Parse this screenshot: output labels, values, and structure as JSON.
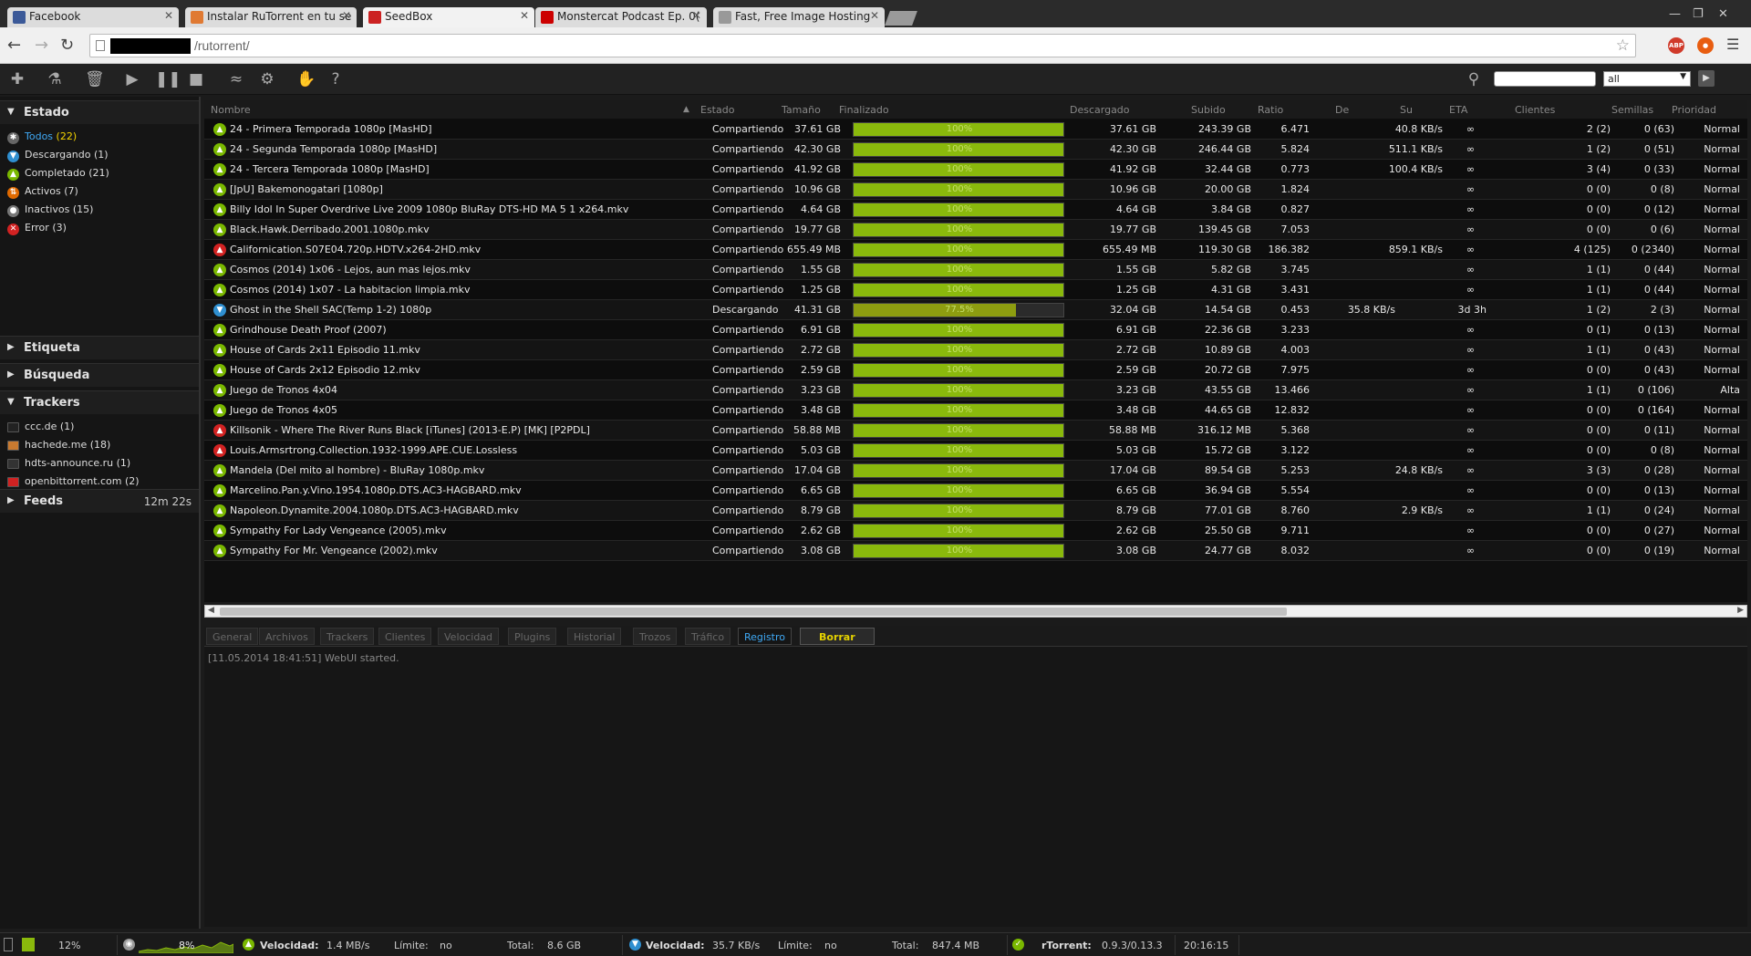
{
  "browser": {
    "tabs": [
      {
        "title": "Facebook",
        "active": false,
        "color": "#3b5998"
      },
      {
        "title": "Instalar RuTorrent en tu se",
        "active": false,
        "color": "#e07a33"
      },
      {
        "title": "SeedBox",
        "active": true,
        "color": "#cc2222"
      },
      {
        "title": "Monstercat Podcast Ep. 0(",
        "active": false,
        "color": "#cc0000"
      },
      {
        "title": "Fast, Free Image Hosting",
        "active": false,
        "color": "#999999"
      }
    ],
    "url": "/rutorrent/",
    "extensions": {
      "abp": "ABP"
    }
  },
  "search": {
    "filter_value": "all"
  },
  "sidebar": {
    "estado": {
      "title": "Estado",
      "items": [
        {
          "label": "Todos",
          "count": "(22)",
          "selected": true,
          "icon": "all-icon",
          "color": "#666666",
          "glyph": "✱"
        },
        {
          "label": "Descargando",
          "count": "(1)",
          "selected": false,
          "icon": "download-icon",
          "color": "#2f8fd0",
          "glyph": "▼"
        },
        {
          "label": "Completado",
          "count": "(21)",
          "selected": false,
          "icon": "complete-icon",
          "color": "#7ab800",
          "glyph": "▲"
        },
        {
          "label": "Activos",
          "count": "(7)",
          "selected": false,
          "icon": "active-icon",
          "color": "#e06a00",
          "glyph": "⇅"
        },
        {
          "label": "Inactivos",
          "count": "(15)",
          "selected": false,
          "icon": "inactive-icon",
          "color": "#777777",
          "glyph": "●"
        },
        {
          "label": "Error",
          "count": "(3)",
          "selected": false,
          "icon": "error-icon",
          "color": "#d22222",
          "glyph": "✕"
        }
      ]
    },
    "etiqueta": {
      "title": "Etiqueta"
    },
    "busqueda": {
      "title": "Búsqueda"
    },
    "trackers": {
      "title": "Trackers",
      "items": [
        {
          "label": "ccc.de (1)",
          "color": "#222222"
        },
        {
          "label": "hachede.me (18)",
          "color": "#c87a30"
        },
        {
          "label": "hdts-announce.ru (1)",
          "color": "#333333"
        },
        {
          "label": "openbittorrent.com (2)",
          "color": "#d02222"
        }
      ]
    },
    "feeds": {
      "title": "Feeds",
      "time": "12m 22s"
    }
  },
  "table": {
    "headers": {
      "name": "Nombre",
      "sort": "▲",
      "status": "Estado",
      "size": "Tamaño",
      "done": "Finalizado",
      "downloaded": "Descargado",
      "uploaded": "Subido",
      "ratio": "Ratio",
      "down": "De",
      "up": "Su",
      "eta": "ETA",
      "peers": "Clientes",
      "seeds": "Semillas",
      "priority": "Prioridad"
    },
    "rows": [
      {
        "state": "seed",
        "name": "24 - Primera Temporada 1080p [MasHD]",
        "status": "Compartiendo",
        "size": "37.61 GB",
        "pct": "100%",
        "done": 100,
        "downloaded": "37.61 GB",
        "uploaded": "243.39 GB",
        "ratio": "6.471",
        "dl": "",
        "ul": "40.8 KB/s",
        "eta": "∞",
        "peers": "2 (2)",
        "seeds": "0 (63)",
        "priority": "Normal"
      },
      {
        "state": "seed",
        "name": "24 - Segunda Temporada 1080p [MasHD]",
        "status": "Compartiendo",
        "size": "42.30 GB",
        "pct": "100%",
        "done": 100,
        "downloaded": "42.30 GB",
        "uploaded": "246.44 GB",
        "ratio": "5.824",
        "dl": "",
        "ul": "511.1 KB/s",
        "eta": "∞",
        "peers": "1 (2)",
        "seeds": "0 (51)",
        "priority": "Normal"
      },
      {
        "state": "seed",
        "name": "24 - Tercera Temporada 1080p [MasHD]",
        "status": "Compartiendo",
        "size": "41.92 GB",
        "pct": "100%",
        "done": 100,
        "downloaded": "41.92 GB",
        "uploaded": "32.44 GB",
        "ratio": "0.773",
        "dl": "",
        "ul": "100.4 KB/s",
        "eta": "∞",
        "peers": "3 (4)",
        "seeds": "0 (33)",
        "priority": "Normal"
      },
      {
        "state": "seed",
        "name": "[JpU] Bakemonogatari [1080p]",
        "status": "Compartiendo",
        "size": "10.96 GB",
        "pct": "100%",
        "done": 100,
        "downloaded": "10.96 GB",
        "uploaded": "20.00 GB",
        "ratio": "1.824",
        "dl": "",
        "ul": "",
        "eta": "∞",
        "peers": "0 (0)",
        "seeds": "0 (8)",
        "priority": "Normal"
      },
      {
        "state": "seed",
        "name": "Billy Idol In Super Overdrive Live 2009 1080p BluRay DTS-HD MA 5 1 x264.mkv",
        "status": "Compartiendo",
        "size": "4.64 GB",
        "pct": "100%",
        "done": 100,
        "downloaded": "4.64 GB",
        "uploaded": "3.84 GB",
        "ratio": "0.827",
        "dl": "",
        "ul": "",
        "eta": "∞",
        "peers": "0 (0)",
        "seeds": "0 (12)",
        "priority": "Normal"
      },
      {
        "state": "seed",
        "name": "Black.Hawk.Derribado.2001.1080p.mkv",
        "status": "Compartiendo",
        "size": "19.77 GB",
        "pct": "100%",
        "done": 100,
        "downloaded": "19.77 GB",
        "uploaded": "139.45 GB",
        "ratio": "7.053",
        "dl": "",
        "ul": "",
        "eta": "∞",
        "peers": "0 (0)",
        "seeds": "0 (6)",
        "priority": "Normal"
      },
      {
        "state": "error",
        "name": "Californication.S07E04.720p.HDTV.x264-2HD.mkv",
        "status": "Compartiendo",
        "size": "655.49 MB",
        "pct": "100%",
        "done": 100,
        "downloaded": "655.49 MB",
        "uploaded": "119.30 GB",
        "ratio": "186.382",
        "dl": "",
        "ul": "859.1 KB/s",
        "eta": "∞",
        "peers": "4 (125)",
        "seeds": "0 (2340)",
        "priority": "Normal"
      },
      {
        "state": "seed",
        "name": "Cosmos (2014) 1x06 - Lejos, aun mas lejos.mkv",
        "status": "Compartiendo",
        "size": "1.55 GB",
        "pct": "100%",
        "done": 100,
        "downloaded": "1.55 GB",
        "uploaded": "5.82 GB",
        "ratio": "3.745",
        "dl": "",
        "ul": "",
        "eta": "∞",
        "peers": "1 (1)",
        "seeds": "0 (44)",
        "priority": "Normal"
      },
      {
        "state": "seed",
        "name": "Cosmos (2014) 1x07 - La habitacion limpia.mkv",
        "status": "Compartiendo",
        "size": "1.25 GB",
        "pct": "100%",
        "done": 100,
        "downloaded": "1.25 GB",
        "uploaded": "4.31 GB",
        "ratio": "3.431",
        "dl": "",
        "ul": "",
        "eta": "∞",
        "peers": "1 (1)",
        "seeds": "0 (44)",
        "priority": "Normal"
      },
      {
        "state": "down",
        "name": "Ghost in the Shell SAC(Temp 1-2) 1080p",
        "status": "Descargando",
        "size": "41.31 GB",
        "pct": "77.5%",
        "done": 77.5,
        "downloaded": "32.04 GB",
        "uploaded": "14.54 GB",
        "ratio": "0.453",
        "dl": "35.8 KB/s",
        "ul": "",
        "eta": "3d 3h",
        "peers": "1 (2)",
        "seeds": "2 (3)",
        "priority": "Normal"
      },
      {
        "state": "seed",
        "name": "Grindhouse Death Proof (2007)",
        "status": "Compartiendo",
        "size": "6.91 GB",
        "pct": "100%",
        "done": 100,
        "downloaded": "6.91 GB",
        "uploaded": "22.36 GB",
        "ratio": "3.233",
        "dl": "",
        "ul": "",
        "eta": "∞",
        "peers": "0 (1)",
        "seeds": "0 (13)",
        "priority": "Normal"
      },
      {
        "state": "seed",
        "name": "House of Cards 2x11 Episodio 11.mkv",
        "status": "Compartiendo",
        "size": "2.72 GB",
        "pct": "100%",
        "done": 100,
        "downloaded": "2.72 GB",
        "uploaded": "10.89 GB",
        "ratio": "4.003",
        "dl": "",
        "ul": "",
        "eta": "∞",
        "peers": "1 (1)",
        "seeds": "0 (43)",
        "priority": "Normal"
      },
      {
        "state": "seed",
        "name": "House of Cards 2x12 Episodio 12.mkv",
        "status": "Compartiendo",
        "size": "2.59 GB",
        "pct": "100%",
        "done": 100,
        "downloaded": "2.59 GB",
        "uploaded": "20.72 GB",
        "ratio": "7.975",
        "dl": "",
        "ul": "",
        "eta": "∞",
        "peers": "0 (0)",
        "seeds": "0 (43)",
        "priority": "Normal"
      },
      {
        "state": "seed",
        "name": "Juego de Tronos 4x04",
        "status": "Compartiendo",
        "size": "3.23 GB",
        "pct": "100%",
        "done": 100,
        "downloaded": "3.23 GB",
        "uploaded": "43.55 GB",
        "ratio": "13.466",
        "dl": "",
        "ul": "",
        "eta": "∞",
        "peers": "1 (1)",
        "seeds": "0 (106)",
        "priority": "Alta"
      },
      {
        "state": "seed",
        "name": "Juego de Tronos 4x05",
        "status": "Compartiendo",
        "size": "3.48 GB",
        "pct": "100%",
        "done": 100,
        "downloaded": "3.48 GB",
        "uploaded": "44.65 GB",
        "ratio": "12.832",
        "dl": "",
        "ul": "",
        "eta": "∞",
        "peers": "0 (0)",
        "seeds": "0 (164)",
        "priority": "Normal"
      },
      {
        "state": "error",
        "name": "Killsonik - Where The River Runs Black [iTunes] (2013-E.P) [MK] [P2PDL]",
        "status": "Compartiendo",
        "size": "58.88 MB",
        "pct": "100%",
        "done": 100,
        "downloaded": "58.88 MB",
        "uploaded": "316.12 MB",
        "ratio": "5.368",
        "dl": "",
        "ul": "",
        "eta": "∞",
        "peers": "0 (0)",
        "seeds": "0 (11)",
        "priority": "Normal"
      },
      {
        "state": "error",
        "name": "Louis.Armsrtrong.Collection.1932-1999.APE.CUE.Lossless",
        "status": "Compartiendo",
        "size": "5.03 GB",
        "pct": "100%",
        "done": 100,
        "downloaded": "5.03 GB",
        "uploaded": "15.72 GB",
        "ratio": "3.122",
        "dl": "",
        "ul": "",
        "eta": "∞",
        "peers": "0 (0)",
        "seeds": "0 (8)",
        "priority": "Normal"
      },
      {
        "state": "seed",
        "name": "Mandela (Del mito al hombre) - BluRay 1080p.mkv",
        "status": "Compartiendo",
        "size": "17.04 GB",
        "pct": "100%",
        "done": 100,
        "downloaded": "17.04 GB",
        "uploaded": "89.54 GB",
        "ratio": "5.253",
        "dl": "",
        "ul": "24.8 KB/s",
        "eta": "∞",
        "peers": "3 (3)",
        "seeds": "0 (28)",
        "priority": "Normal"
      },
      {
        "state": "seed",
        "name": "Marcelino.Pan.y.Vino.1954.1080p.DTS.AC3-HAGBARD.mkv",
        "status": "Compartiendo",
        "size": "6.65 GB",
        "pct": "100%",
        "done": 100,
        "downloaded": "6.65 GB",
        "uploaded": "36.94 GB",
        "ratio": "5.554",
        "dl": "",
        "ul": "",
        "eta": "∞",
        "peers": "0 (0)",
        "seeds": "0 (13)",
        "priority": "Normal"
      },
      {
        "state": "seed",
        "name": "Napoleon.Dynamite.2004.1080p.DTS.AC3-HAGBARD.mkv",
        "status": "Compartiendo",
        "size": "8.79 GB",
        "pct": "100%",
        "done": 100,
        "downloaded": "8.79 GB",
        "uploaded": "77.01 GB",
        "ratio": "8.760",
        "dl": "",
        "ul": "2.9 KB/s",
        "eta": "∞",
        "peers": "1 (1)",
        "seeds": "0 (24)",
        "priority": "Normal"
      },
      {
        "state": "seed",
        "name": "Sympathy For Lady Vengeance (2005).mkv",
        "status": "Compartiendo",
        "size": "2.62 GB",
        "pct": "100%",
        "done": 100,
        "downloaded": "2.62 GB",
        "uploaded": "25.50 GB",
        "ratio": "9.711",
        "dl": "",
        "ul": "",
        "eta": "∞",
        "peers": "0 (0)",
        "seeds": "0 (27)",
        "priority": "Normal"
      },
      {
        "state": "seed",
        "name": "Sympathy For Mr. Vengeance (2002).mkv",
        "status": "Compartiendo",
        "size": "3.08 GB",
        "pct": "100%",
        "done": 100,
        "downloaded": "3.08 GB",
        "uploaded": "24.77 GB",
        "ratio": "8.032",
        "dl": "",
        "ul": "",
        "eta": "∞",
        "peers": "0 (0)",
        "seeds": "0 (19)",
        "priority": "Normal"
      }
    ]
  },
  "bottom_tabs": [
    "General",
    "Archivos",
    "Trackers",
    "Clientes",
    "Velocidad",
    "Plugins",
    "Historial",
    "Trozos",
    "Tráfico",
    "Registro"
  ],
  "bottom_active": "Registro",
  "clear_label": "Borrar",
  "log": "[11.05.2014 18:41:51] WebUI started.",
  "status": {
    "disk_pct": "12%",
    "cpu_pct": "8%",
    "dl_label": "Velocidad:",
    "dl_speed": "1.4 MB/s",
    "dl_limit_label": "Límite:",
    "dl_limit": "no",
    "dl_total_label": "Total:",
    "dl_total": "8.6 GB",
    "ul_label": "Velocidad:",
    "ul_speed": "35.7 KB/s",
    "ul_limit_label": "Límite:",
    "ul_limit": "no",
    "ul_total_label": "Total:",
    "ul_total": "847.4 MB",
    "client_label": "rTorrent:",
    "client_version": "0.9.3/0.13.3",
    "time": "20:16:15"
  }
}
